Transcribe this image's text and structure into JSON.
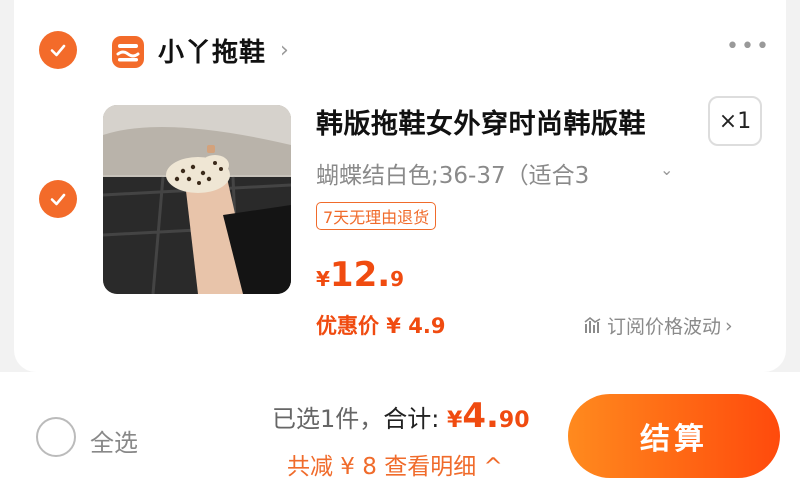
{
  "shop": {
    "name": "小丫拖鞋",
    "icon": "shop-store-icon"
  },
  "item": {
    "title": "韩版拖鞋女外穿时尚韩版鞋",
    "quantity_label": "×1",
    "sku": "蝴蝶结白色;36-37（适合3",
    "tag": "7天无理由退货",
    "price_currency": "¥",
    "price_int": "12.",
    "price_dec": "9",
    "discount_label": "优惠价 ¥ 4.9",
    "subscribe_label": "订阅价格波动"
  },
  "footer": {
    "select_all": "全选",
    "selected": "已选1件，",
    "total_label": "合计:",
    "total_currency": "¥",
    "total_int": "4.",
    "total_dec": "90",
    "savings": "共减 ¥ 8  查看明细 ^",
    "checkout": "结算"
  },
  "colors": {
    "accent": "#f36b2a",
    "price": "#f04b10",
    "button_start": "#ff8a1e",
    "button_end": "#ff4a0c"
  }
}
